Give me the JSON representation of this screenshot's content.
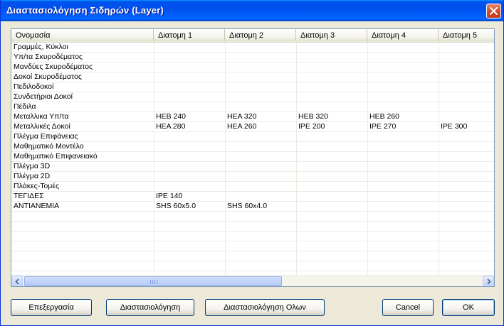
{
  "window": {
    "title": "Διαστασιολόγηση Σιδηρών (Layer)",
    "close_glyph": "✕"
  },
  "table": {
    "columns": [
      "Ονομασία",
      "Διατομη 1",
      "Διατομη 2",
      "Διατομη 3",
      "Διατομη 4",
      "Διατομη 5"
    ],
    "rows": [
      [
        "Γραμμές, Κύκλοι",
        "",
        "",
        "",
        "",
        ""
      ],
      [
        "Υπ/τα Σκυροδέματος",
        "",
        "",
        "",
        "",
        ""
      ],
      [
        "Μανδύες Σκυροδέματος",
        "",
        "",
        "",
        "",
        ""
      ],
      [
        "Δοκοί Σκυροδέματος",
        "",
        "",
        "",
        "",
        ""
      ],
      [
        "Πεδιλοδοκοί",
        "",
        "",
        "",
        "",
        ""
      ],
      [
        "Συνδετήριοι Δοκοί",
        "",
        "",
        "",
        "",
        ""
      ],
      [
        "Πέδιλα",
        "",
        "",
        "",
        "",
        ""
      ],
      [
        "Μεταλλικα Υπ/τα",
        "HEB 240",
        "HEA 320",
        "HEB 320",
        "HEB 260",
        ""
      ],
      [
        "Μεταλλικές Δοκοί",
        "HEA 280",
        "HEA 260",
        "IPE 200",
        "IPE 270",
        "IPE 300"
      ],
      [
        "Πλέγμα Επιφάνειας",
        "",
        "",
        "",
        "",
        ""
      ],
      [
        "Μαθηματικό Μοντέλο",
        "",
        "",
        "",
        "",
        ""
      ],
      [
        "Μαθηματικό Επιφανειακό",
        "",
        "",
        "",
        "",
        ""
      ],
      [
        "Πλέγμα 3D",
        "",
        "",
        "",
        "",
        ""
      ],
      [
        "Πλέγμα 2D",
        "",
        "",
        "",
        "",
        ""
      ],
      [
        "Πλάκες-Τομές",
        "",
        "",
        "",
        "",
        ""
      ],
      [
        "ΤΕΓΙΔΕΣ",
        "IPE 140",
        "",
        "",
        "",
        ""
      ],
      [
        "ΑΝΤΙΑΝΕΜΙΑ",
        "SHS 60x5.0",
        "SHS 60x4.0",
        "",
        "",
        ""
      ],
      [
        "",
        "",
        "",
        "",
        "",
        ""
      ],
      [
        "",
        "",
        "",
        "",
        "",
        ""
      ],
      [
        "",
        "",
        "",
        "",
        "",
        ""
      ],
      [
        "",
        "",
        "",
        "",
        "",
        ""
      ],
      [
        "",
        "",
        "",
        "",
        "",
        ""
      ],
      [
        "",
        "",
        "",
        "",
        "",
        ""
      ]
    ]
  },
  "buttons": {
    "edit": "Επεξεργασία",
    "dimension": "Διαστασιολόγηση",
    "dimension_all": "Διαστασιολόγηση Ολων",
    "cancel": "Cancel",
    "ok": "OK"
  },
  "icons": {
    "close": "close-icon",
    "scroll_left": "arrow-left-icon",
    "scroll_right": "arrow-right-icon"
  },
  "colors": {
    "titlebar": "#0054e3",
    "dialog_bg": "#ece9d8",
    "close_button": "#d24d2a"
  }
}
